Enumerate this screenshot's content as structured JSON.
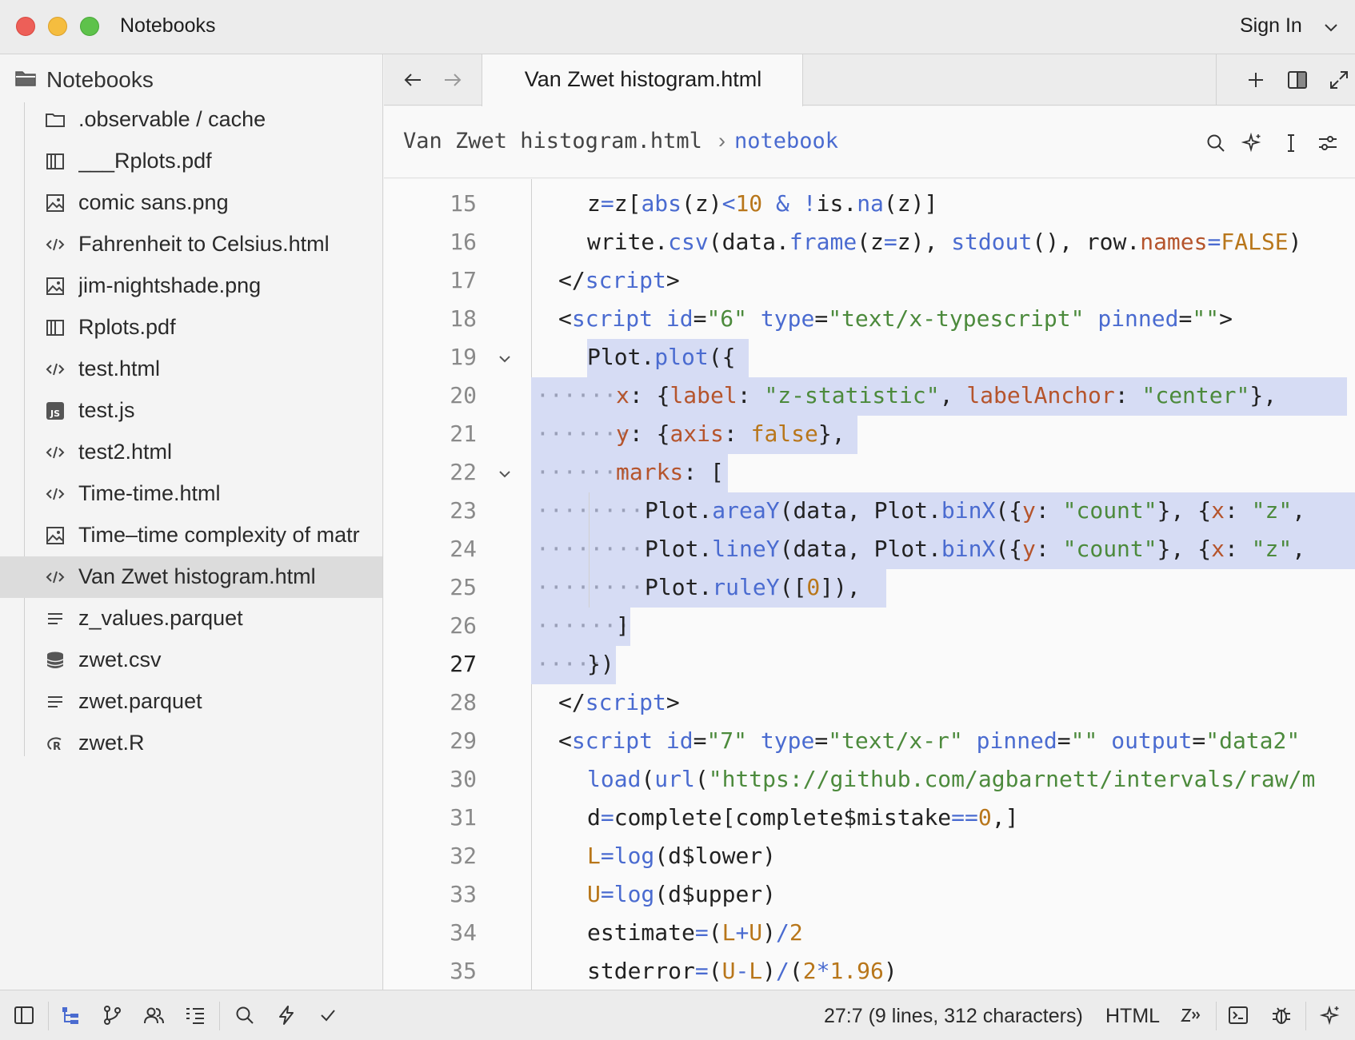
{
  "window": {
    "title": "Notebooks",
    "sign_in": "Sign In"
  },
  "sidebar": {
    "root": "Notebooks",
    "items": [
      {
        "label": ".observable / cache",
        "icon": "folder-icon"
      },
      {
        "label": "___Rplots.pdf",
        "icon": "book-icon"
      },
      {
        "label": "comic sans.png",
        "icon": "image-icon"
      },
      {
        "label": "Fahrenheit to Celsius.html",
        "icon": "code-icon"
      },
      {
        "label": "jim-nightshade.png",
        "icon": "image-icon"
      },
      {
        "label": "Rplots.pdf",
        "icon": "book-icon"
      },
      {
        "label": "test.html",
        "icon": "code-icon"
      },
      {
        "label": "test.js",
        "icon": "js-icon"
      },
      {
        "label": "test2.html",
        "icon": "code-icon"
      },
      {
        "label": "Time-time.html",
        "icon": "code-icon"
      },
      {
        "label": "Time–time complexity of matr",
        "icon": "image-icon"
      },
      {
        "label": "Van Zwet histogram.html",
        "icon": "code-icon",
        "active": true
      },
      {
        "label": "z_values.parquet",
        "icon": "lines-icon"
      },
      {
        "label": "zwet.csv",
        "icon": "database-icon"
      },
      {
        "label": "zwet.parquet",
        "icon": "lines-icon"
      },
      {
        "label": "zwet.R",
        "icon": "r-icon"
      }
    ]
  },
  "tabs": {
    "active": "Van Zwet histogram.html"
  },
  "breadcrumb": {
    "file": "Van Zwet histogram.html",
    "separator": "›",
    "section": "notebook"
  },
  "editor": {
    "line_numbers": [
      "15",
      "16",
      "17",
      "18",
      "19",
      "20",
      "21",
      "22",
      "23",
      "24",
      "25",
      "26",
      "27",
      "28",
      "29",
      "30",
      "31",
      "32",
      "33",
      "34",
      "35"
    ]
  },
  "status": {
    "position": "27:7 (9 lines, 312 characters)",
    "language": "HTML"
  },
  "colors": {
    "selection": "#d6dcf4",
    "keyword": "#4a6bd0",
    "string": "#4c8a3c",
    "property": "#b5542c",
    "number": "#b8761a"
  }
}
